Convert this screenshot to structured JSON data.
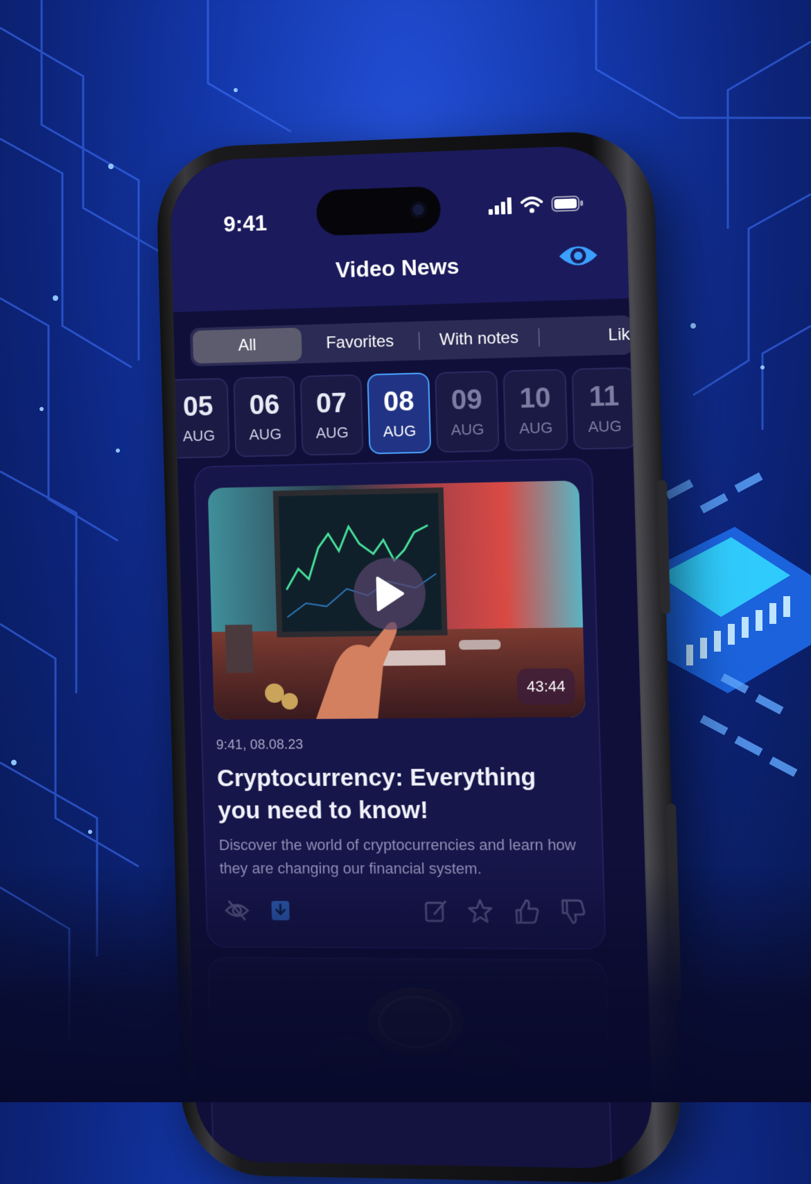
{
  "status_bar": {
    "time": "9:41"
  },
  "header": {
    "title": "Video News",
    "eye_icon": "eye-icon"
  },
  "tabs": [
    {
      "label": "All",
      "active": true
    },
    {
      "label": "Favorites",
      "active": false
    },
    {
      "label": "With notes",
      "active": false
    },
    {
      "label": "Lik",
      "active": false
    }
  ],
  "dates": [
    {
      "day": "05",
      "month": "AUG",
      "state": "normal"
    },
    {
      "day": "06",
      "month": "AUG",
      "state": "normal"
    },
    {
      "day": "07",
      "month": "AUG",
      "state": "normal"
    },
    {
      "day": "08",
      "month": "AUG",
      "state": "selected"
    },
    {
      "day": "09",
      "month": "AUG",
      "state": "dim"
    },
    {
      "day": "10",
      "month": "AUG",
      "state": "dim"
    },
    {
      "day": "11",
      "month": "AUG",
      "state": "dim"
    }
  ],
  "card": {
    "duration": "43:44",
    "timestamp": "9:41, 08.08.23",
    "title": "Cryptocurrency: Everything you need to know!",
    "description": "Discover the world of cryptocurrencies and learn how they are changing our financial system.",
    "actions": [
      "eye-off-icon",
      "download-icon",
      "edit-note-icon",
      "star-icon",
      "thumbs-up-icon",
      "thumbs-down-icon"
    ]
  },
  "colors": {
    "accent": "#3aa0ff",
    "header_bg": "#1b1a5c",
    "screen_bg": "#100f3a",
    "selected_date_border": "#4aa6ff"
  }
}
